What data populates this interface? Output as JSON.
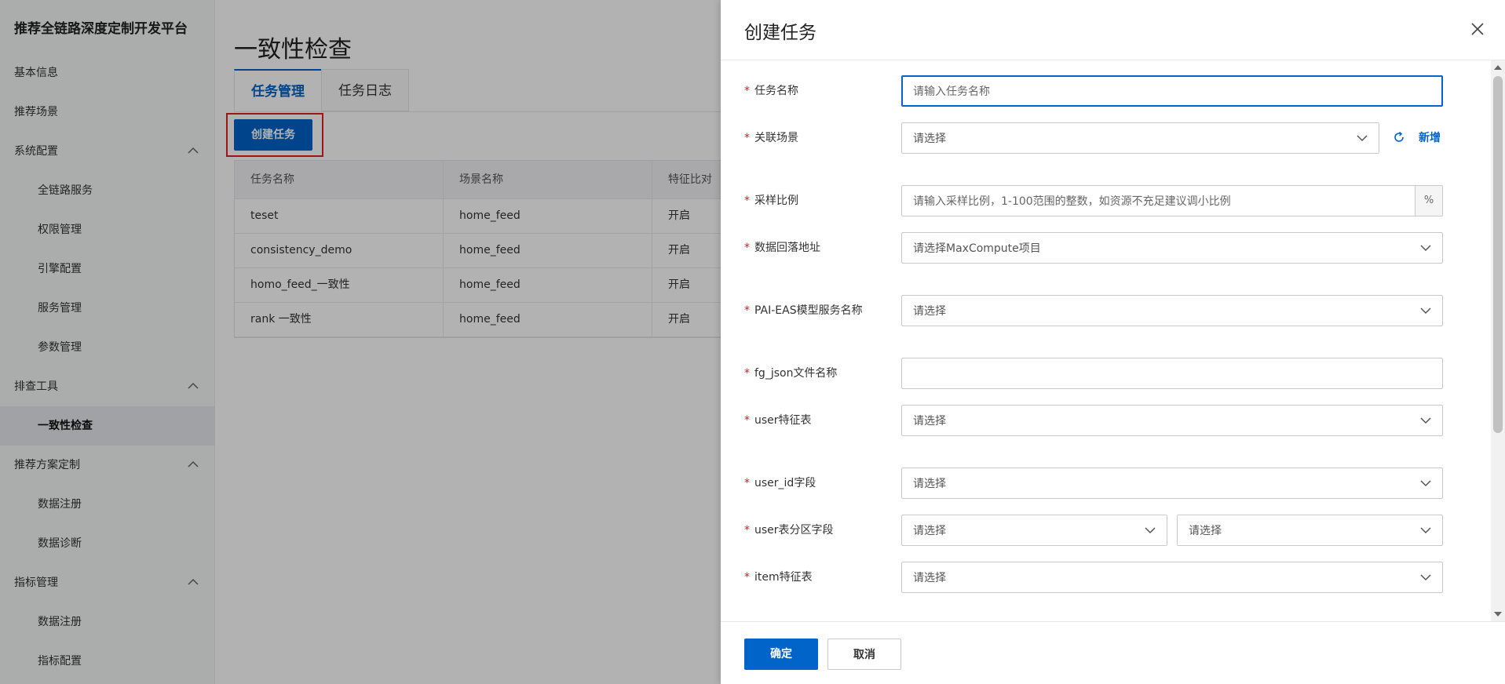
{
  "sidebar": {
    "title": "推荐全链路深度定制开发平台",
    "items": [
      {
        "label": "基本信息"
      },
      {
        "label": "推荐场景"
      },
      {
        "label": "系统配置"
      },
      {
        "label": "全链路服务"
      },
      {
        "label": "权限管理"
      },
      {
        "label": "引擎配置"
      },
      {
        "label": "服务管理"
      },
      {
        "label": "参数管理"
      },
      {
        "label": "排查工具"
      },
      {
        "label": "一致性检查"
      },
      {
        "label": "推荐方案定制"
      },
      {
        "label": "数据注册"
      },
      {
        "label": "数据诊断"
      },
      {
        "label": "指标管理"
      },
      {
        "label": "数据注册"
      },
      {
        "label": "指标配置"
      }
    ]
  },
  "main": {
    "title": "一致性检查",
    "tabs": [
      {
        "label": "任务管理"
      },
      {
        "label": "任务日志"
      }
    ],
    "create_button": "创建任务",
    "table": {
      "headers": [
        "任务名称",
        "场景名称",
        "特征比对"
      ],
      "rows": [
        [
          "teset",
          "home_feed",
          "开启"
        ],
        [
          "consistency_demo",
          "home_feed",
          "开启"
        ],
        [
          "homo_feed_一致性",
          "home_feed",
          "开启"
        ],
        [
          "rank 一致性",
          "home_feed",
          "开启"
        ]
      ]
    }
  },
  "drawer": {
    "title": "创建任务",
    "fields": {
      "task_name": {
        "label": "任务名称",
        "placeholder": "请输入任务名称"
      },
      "scene": {
        "label": "关联场景",
        "value": "请选择",
        "add": "新增"
      },
      "sample_ratio": {
        "label": "采样比例",
        "placeholder": "请输入采样比例，1-100范围的整数，如资源不充足建议调小比例",
        "unit": "%"
      },
      "data_address": {
        "label": "数据回落地址",
        "value": "请选择MaxCompute项目"
      },
      "pai_eas": {
        "label": "PAI-EAS模型服务名称",
        "value": "请选择"
      },
      "fg_json": {
        "label": "fg_json文件名称",
        "placeholder": ""
      },
      "user_table": {
        "label": "user特征表",
        "value": "请选择"
      },
      "user_id": {
        "label": "user_id字段",
        "value": "请选择"
      },
      "user_partition": {
        "label": "user表分区字段",
        "value1": "请选择",
        "value2": "请选择"
      },
      "item_table": {
        "label": "item特征表",
        "value": "请选择"
      }
    },
    "ok_button": "确定",
    "cancel_button": "取消"
  },
  "colors": {
    "primary": "#0064c8",
    "required": "#e02020",
    "highlight": "#e02020"
  }
}
